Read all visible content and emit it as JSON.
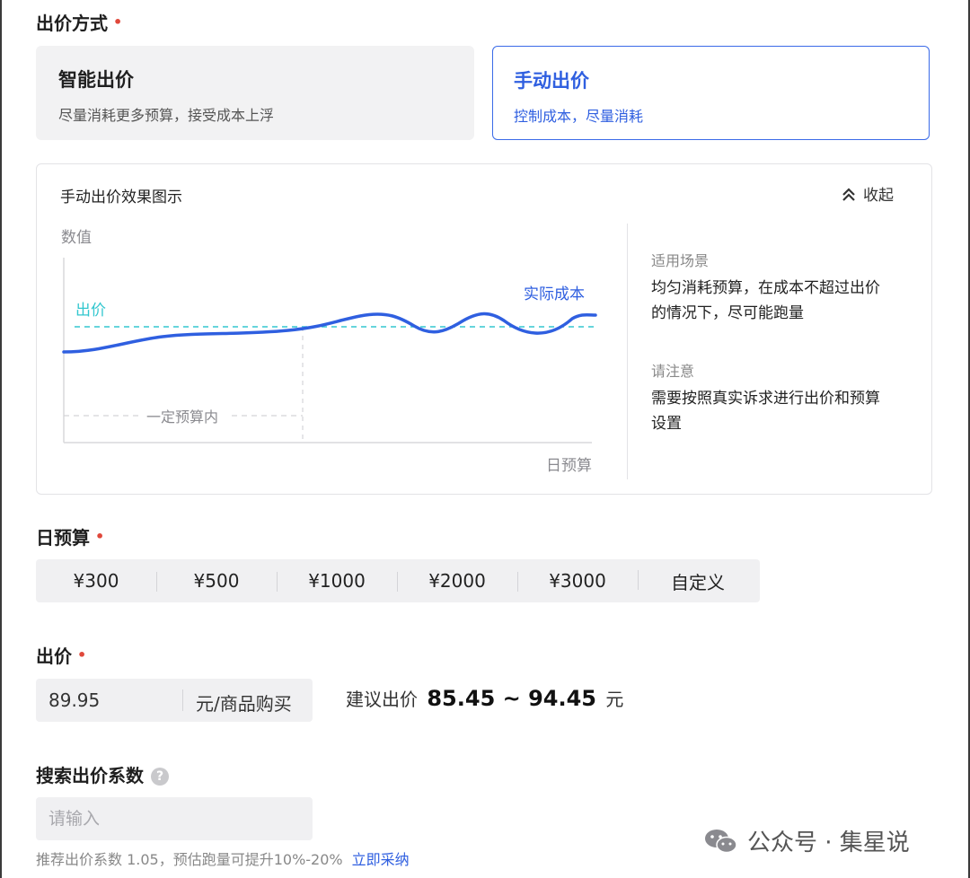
{
  "bid_method": {
    "title": "出价方式",
    "required_mark": "•",
    "options": [
      {
        "title": "智能出价",
        "desc": "尽量消耗更多预算，接受成本上浮",
        "selected": false
      },
      {
        "title": "手动出价",
        "desc": "控制成本，尽量消耗",
        "selected": true
      }
    ]
  },
  "effect_panel": {
    "title": "手动出价效果图示",
    "collapse_label": "收起",
    "chart_data": {
      "type": "line",
      "ylabel": "数值",
      "xlabel": "日预算",
      "reference_line_label": "出价",
      "series_label": "实际成本",
      "budget_marker_label": "一定预算内"
    },
    "scene_label": "适用场景",
    "scene_text": "均匀消耗预算，在成本不超过出价的情况下，尽可能跑量",
    "note_label": "请注意",
    "note_text": "需要按照真实诉求进行出价和预算设置"
  },
  "daily_budget": {
    "title": "日预算",
    "required_mark": "•",
    "options": [
      "¥300",
      "¥500",
      "¥1000",
      "¥2000",
      "¥3000",
      "自定义"
    ]
  },
  "bid": {
    "title": "出价",
    "required_mark": "•",
    "value": "89.95",
    "unit": "元/商品购买",
    "suggest_prefix": "建议出价",
    "suggest_range": "85.45 ~ 94.45",
    "suggest_suffix": "元"
  },
  "search_coef": {
    "title": "搜索出价系数",
    "help_icon": "?",
    "placeholder": "请输入",
    "tip": "推荐出价系数 1.05，预估跑量可提升10%-20%",
    "adopt_link": "立即采纳"
  },
  "watermark": {
    "text": "公众号 · 集星说"
  },
  "colors": {
    "accent": "#2f5fe0",
    "cost_line": "#2f5fe0",
    "bid_line": "#33c7cf",
    "required": "#e0483b"
  }
}
